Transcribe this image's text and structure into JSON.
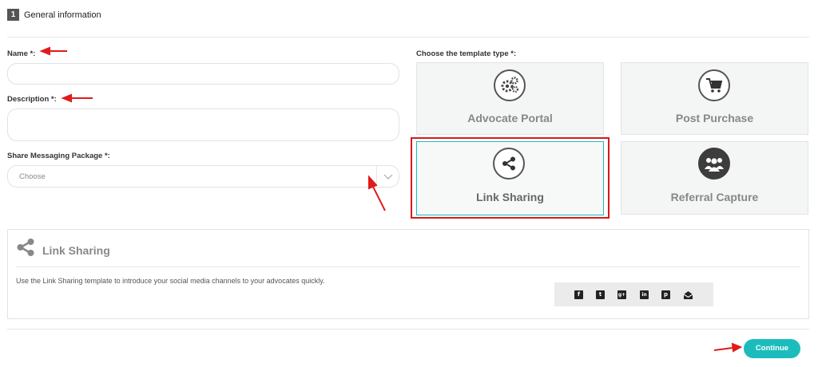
{
  "step": {
    "number": "1",
    "title": "General information"
  },
  "form": {
    "name_label": "Name *:",
    "name_value": "",
    "description_label": "Description *:",
    "description_value": "",
    "package_label": "Share Messaging Package *:",
    "package_selected": "Choose"
  },
  "templates": {
    "label": "Choose the template type *:",
    "cards": [
      {
        "label": "Advocate Portal",
        "icon": "gears-icon",
        "selected": false
      },
      {
        "label": "Post Purchase",
        "icon": "cart-icon",
        "selected": false
      },
      {
        "label": "Link Sharing",
        "icon": "share-icon",
        "selected": true
      },
      {
        "label": "Referral Capture",
        "icon": "users-icon",
        "selected": false
      }
    ]
  },
  "preview": {
    "title": "Link Sharing",
    "description": "Use the Link Sharing template to introduce your social media channels to your advocates quickly.",
    "social_icons": [
      "facebook-icon",
      "twitter-icon",
      "google-plus-icon",
      "linkedin-icon",
      "pinterest-icon",
      "email-icon"
    ]
  },
  "footer": {
    "continue_label": "Continue"
  },
  "colors": {
    "accent": "#1cbcbc",
    "annotation_red": "#e01b1b",
    "selected_border": "#1cbcbc"
  }
}
